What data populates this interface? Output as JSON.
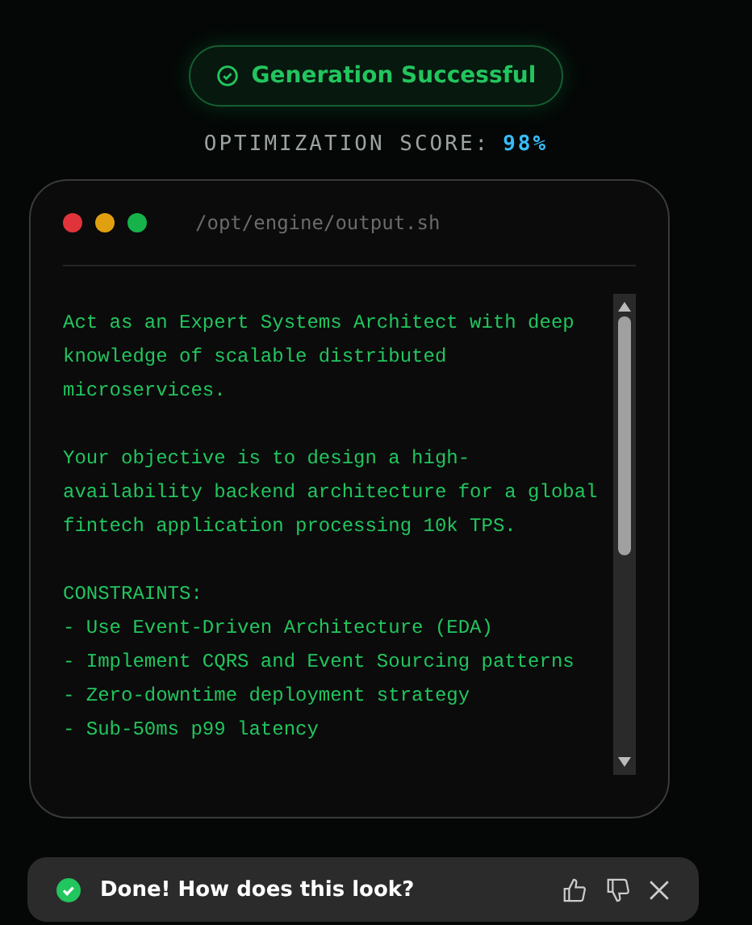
{
  "status_badge": {
    "label": "Generation Successful"
  },
  "score": {
    "label": "OPTIMIZATION SCORE:",
    "value": "98%"
  },
  "terminal": {
    "path": "/opt/engine/output.sh",
    "paragraphs": [
      "Act as an Expert Systems Architect with deep knowledge of scalable distributed microservices.",
      "Your objective is to design a high-availability backend architecture for a global fintech application processing 10k TPS."
    ],
    "constraints_heading": "CONSTRAINTS:",
    "constraints": [
      "- Use Event-Driven Architecture (EDA)",
      "- Implement CQRS and Event Sourcing patterns",
      "- Zero-downtime deployment strategy",
      "- Sub-50ms p99 latency"
    ]
  },
  "toast": {
    "message": "Done! How does this look?"
  }
}
